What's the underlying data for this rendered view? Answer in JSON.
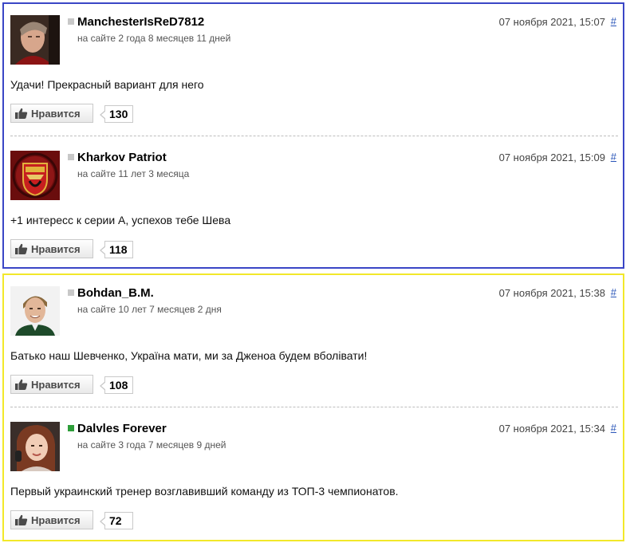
{
  "like_label": "Нравится",
  "hash_symbol": "#",
  "colors": {
    "group_1_border": "#3a46c6",
    "group_2_border": "#f2e82a",
    "link": "#2a55b8",
    "status_online": "#2e9e3a",
    "status_offline": "#c8c8c8"
  },
  "comments": [
    {
      "username": "ManchesterIsReD7812",
      "membership": "на сайте 2 года 8 месяцев 11 дней",
      "date": "07 ноября 2021, 15:07",
      "text": "Удачи! Прекрасный вариант для него",
      "likes": "130",
      "status": "offline",
      "avatar": "man-portrait-avatar"
    },
    {
      "username": "Kharkov Patriot",
      "membership": "на сайте 11 лет 3 месяца",
      "date": "07 ноября 2021, 15:09",
      "text": "+1 интересс к серии А, успехов тебе Шева",
      "likes": "118",
      "status": "offline",
      "avatar": "manchester-united-crest-avatar"
    },
    {
      "username": "Bohdan_B.M.",
      "membership": "на сайте 10 лет 7 месяцев 2 дня",
      "date": "07 ноября 2021, 15:38",
      "text": "Батько наш Шевченко, Україна мати, ми за Дженоа будем вболівати!",
      "likes": "108",
      "status": "offline",
      "avatar": "smiling-man-avatar"
    },
    {
      "username": "Dalvles Forever",
      "membership": "на сайте 3 года 7 месяцев 9 дней",
      "date": "07 ноября 2021, 15:34",
      "text": "Первый украинский тренер возглавивший команду из ТОП-3 чемпионатов.",
      "likes": "72",
      "status": "online",
      "avatar": "woman-portrait-avatar"
    }
  ]
}
